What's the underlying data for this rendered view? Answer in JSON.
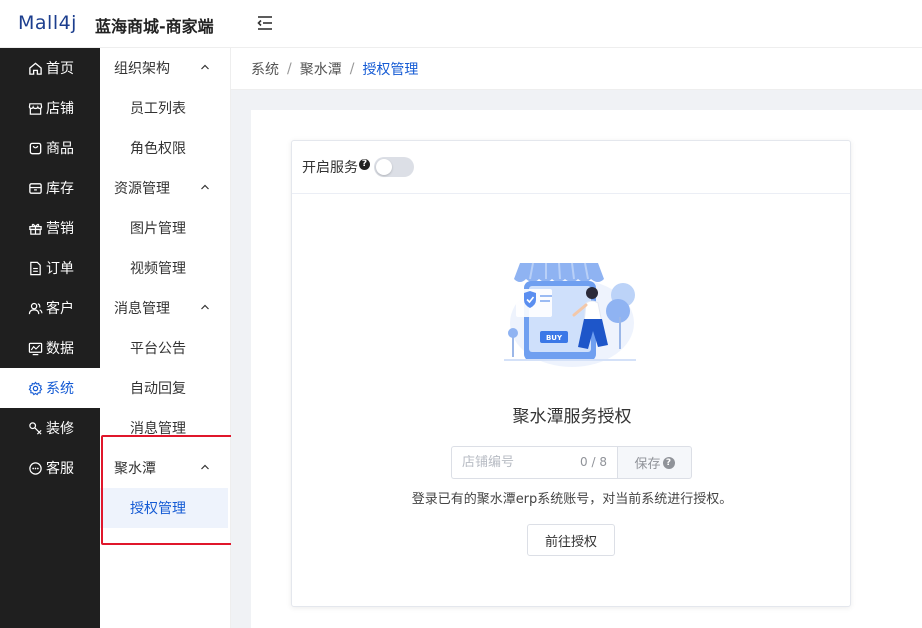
{
  "header": {
    "logo": "Mall4j",
    "title": "蓝海商城-商家端"
  },
  "sidebar": {
    "items": [
      {
        "label": "首页",
        "icon": "home-icon"
      },
      {
        "label": "店铺",
        "icon": "shop-icon"
      },
      {
        "label": "商品",
        "icon": "product-icon"
      },
      {
        "label": "库存",
        "icon": "inventory-icon"
      },
      {
        "label": "营销",
        "icon": "gift-icon"
      },
      {
        "label": "订单",
        "icon": "order-icon"
      },
      {
        "label": "客户",
        "icon": "customer-icon"
      },
      {
        "label": "数据",
        "icon": "data-icon"
      },
      {
        "label": "系统",
        "icon": "gear-icon",
        "active": true
      },
      {
        "label": "装修",
        "icon": "decoration-icon"
      },
      {
        "label": "客服",
        "icon": "chat-icon"
      }
    ]
  },
  "submenu": {
    "groups": [
      {
        "label": "组织架构",
        "items": [
          "员工列表",
          "角色权限"
        ]
      },
      {
        "label": "资源管理",
        "items": [
          "图片管理",
          "视频管理"
        ]
      },
      {
        "label": "消息管理",
        "items": [
          "平台公告",
          "自动回复",
          "消息管理"
        ]
      },
      {
        "label": "聚水潭",
        "items": [
          "授权管理"
        ]
      }
    ],
    "active_item": "授权管理"
  },
  "breadcrumb": [
    "系统",
    "聚水潭",
    "授权管理"
  ],
  "card": {
    "service_label": "开启服务",
    "service_enabled": false,
    "title": "聚水潭服务授权",
    "shop_input": {
      "placeholder": "店铺编号",
      "value": "",
      "counter": "0 / 8"
    },
    "save_label": "保存",
    "description": "登录已有的聚水潭erp系统账号，对当前系统进行授权。",
    "authorize_label": "前往授权",
    "illustration_badge": "BUY"
  },
  "colors": {
    "accent": "#155bd4",
    "sidebar_bg": "#1f1f1f",
    "highlight": "#e0162b"
  }
}
